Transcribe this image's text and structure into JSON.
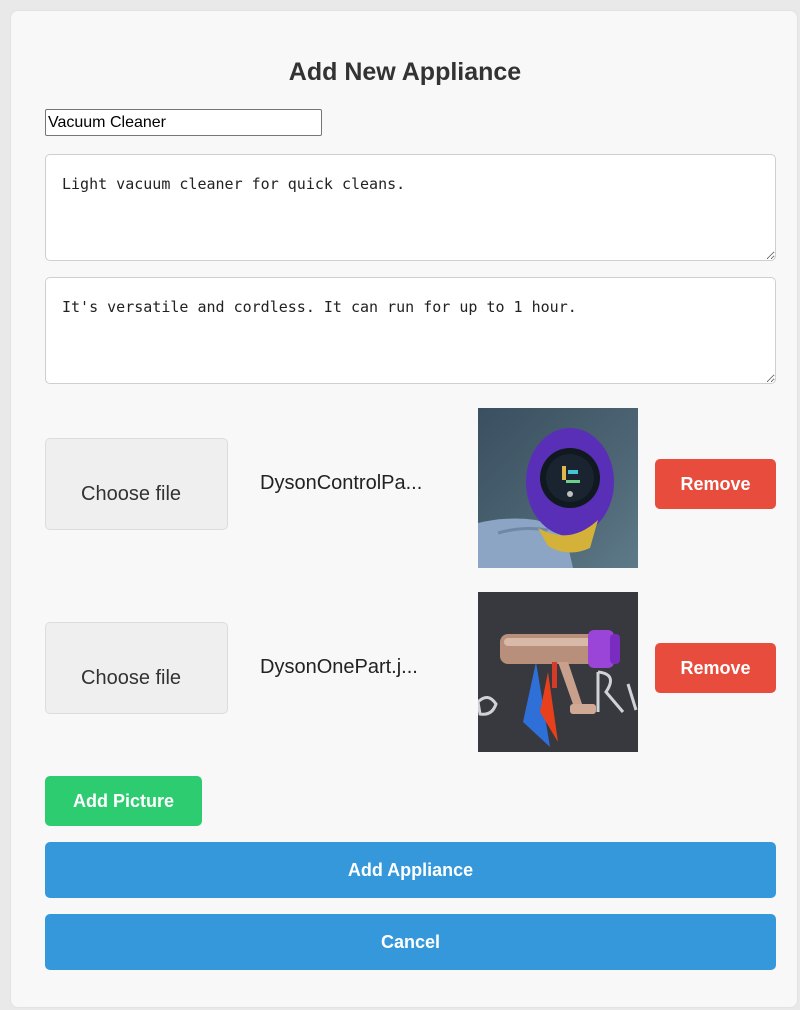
{
  "form": {
    "title": "Add New Appliance",
    "name_value": "Vacuum Cleaner",
    "short_description": "Light vacuum cleaner for quick cleans.",
    "long_description": "It's versatile and cordless. It can run for up to 1 hour."
  },
  "pictures": [
    {
      "choose_label": "Choose file",
      "file_name": "DysonControlPa...",
      "image": "vacuum-display-photo",
      "remove_label": "Remove"
    },
    {
      "choose_label": "Choose file",
      "file_name": "DysonOnePart.j...",
      "image": "vacuum-part-photo",
      "remove_label": "Remove"
    }
  ],
  "actions": {
    "add_picture_label": "Add Picture",
    "submit_label": "Add Appliance",
    "cancel_label": "Cancel"
  },
  "colors": {
    "danger": "#e74c3c",
    "success": "#2ecc71",
    "primary": "#3498db"
  }
}
